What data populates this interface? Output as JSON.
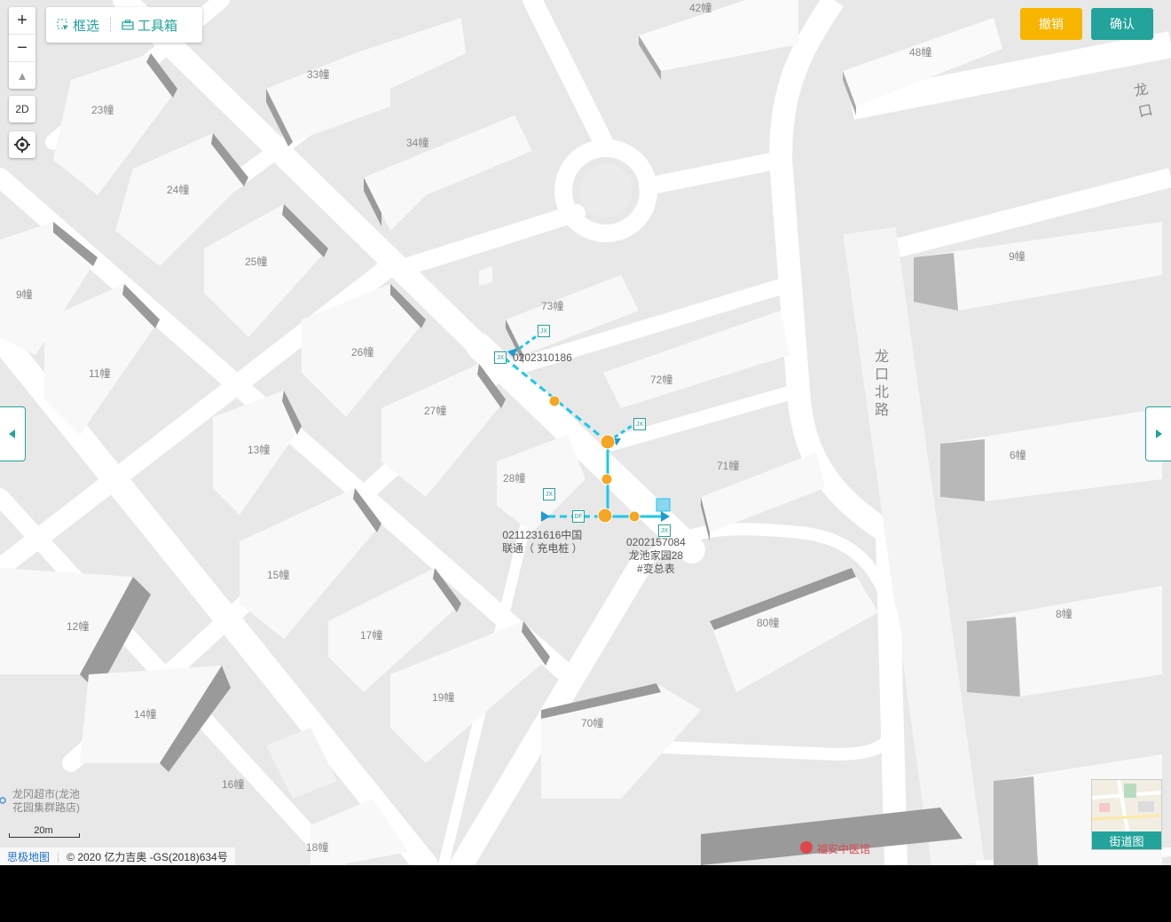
{
  "toolbar": {
    "zoom_in": "+",
    "zoom_out": "−",
    "compass": "▲",
    "mode_2d": "2D",
    "box_select": "框选",
    "toolbox": "工具箱"
  },
  "actions": {
    "undo": "撤销",
    "confirm": "确认",
    "undo_color": "#f7b500",
    "confirm_color": "#22a39b"
  },
  "buildings": [
    "42幢",
    "48幢",
    "33幢",
    "23幢",
    "34幢",
    "24幢",
    "25幢",
    "9幢",
    "73幢",
    "9幢",
    "26幢",
    "11幢",
    "72幢",
    "27幢",
    "13幢",
    "71幢",
    "6幢",
    "28幢",
    "15幢",
    "12幢",
    "17幢",
    "8幢",
    "80幢",
    "19幢",
    "14幢",
    "70幢",
    "16幢",
    "18幢"
  ],
  "roads": {
    "longkou_road": "龙口",
    "longkou_north_road": "龙口北路"
  },
  "devices": {
    "d1": "0202310186",
    "d2_line1": "0211231616中国",
    "d2_line2": "联通（ 充电桩 ）",
    "d3_line1": "0202157084",
    "d3_line2": "龙池家园28",
    "d3_line3": "#变总表",
    "box_code": "JX",
    "box_code2": "DF"
  },
  "poi": {
    "market_line1": "龙冈超市(龙池",
    "market_line2": "花园集群路店)",
    "hospital": "福安中医馆"
  },
  "street_view": "街道图",
  "scale": "20m",
  "footer": {
    "brand": "思极地图",
    "copyright": "© 2020 亿力吉奥 -GS(2018)634号"
  },
  "colors": {
    "line": "#1ec8e6",
    "node": "#f5a623",
    "accent": "#22a39b"
  }
}
